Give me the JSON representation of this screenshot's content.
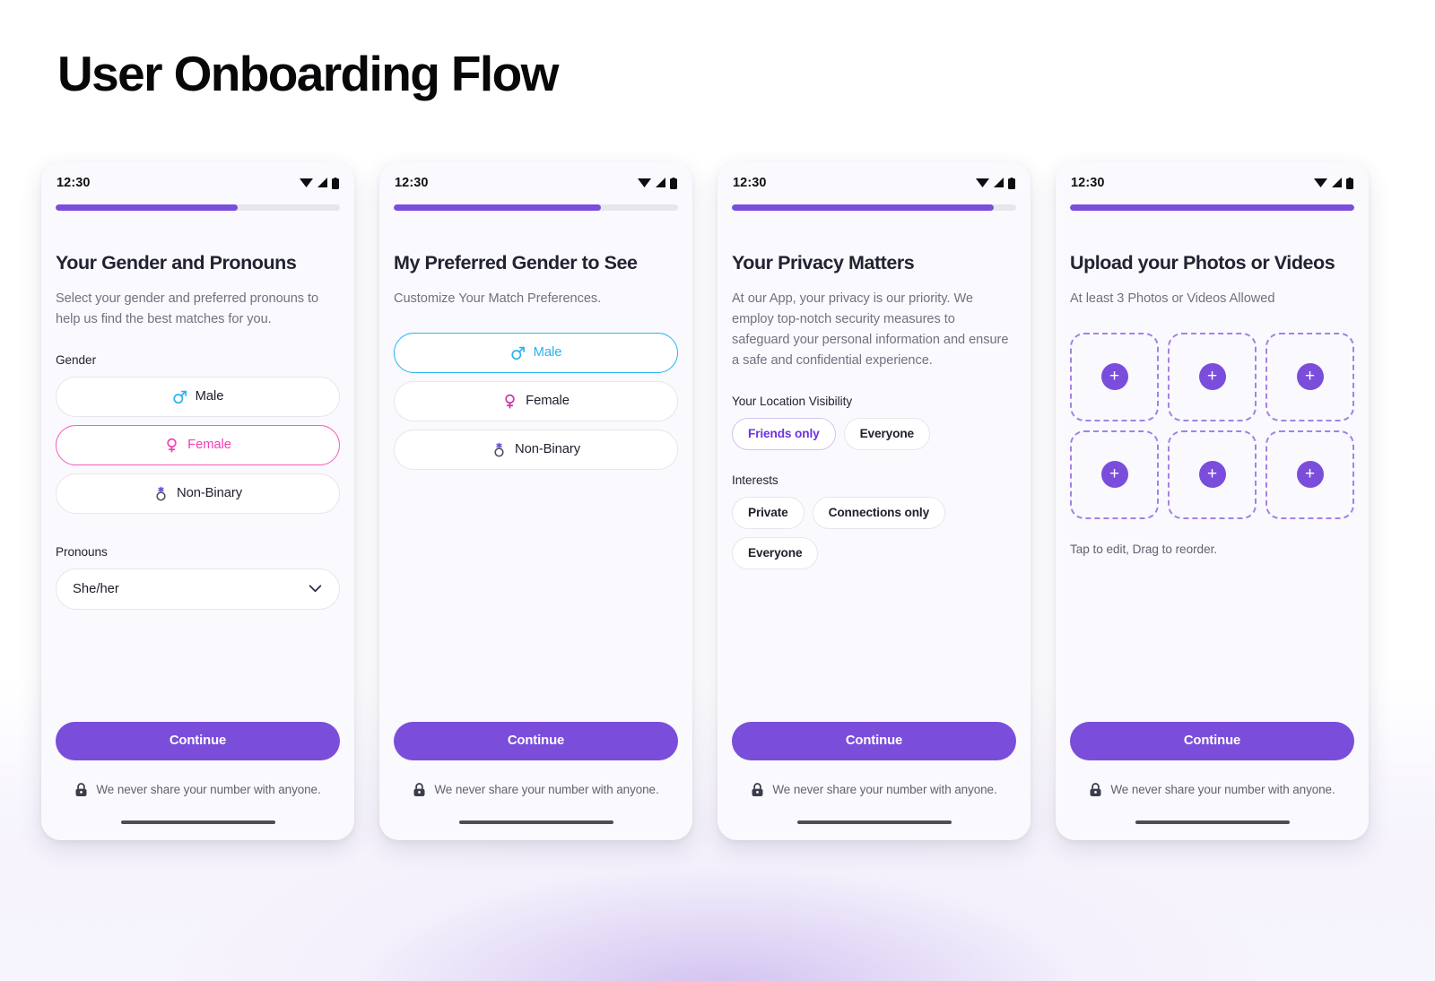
{
  "page": {
    "title": "User Onboarding Flow",
    "accent_purple": "#7a4edb",
    "accent_blue": "#28b4ef",
    "accent_pink": "#f33fb4",
    "heading_color": "#222331",
    "body_color": "#6f7280",
    "phone_bg": "#faf9fd"
  },
  "common": {
    "status_time": "12:30",
    "continue_label": "Continue",
    "footnote": "We never share your number with anyone.",
    "icons": {
      "wifi": "wifi-icon",
      "signal": "signal-icon",
      "battery": "battery-icon",
      "lock": "lock-icon",
      "chevron": "chevron-down-icon",
      "plus": "plus-icon"
    }
  },
  "screens": [
    {
      "id": "gender-pronouns",
      "progress_percent": 64,
      "title": "Your Gender and Pronouns",
      "subtitle": "Select your gender and preferred pronouns to help us find the best matches for you.",
      "gender_label": "Gender",
      "gender_options": [
        {
          "label": "Male",
          "symbol": "♂",
          "state": "default"
        },
        {
          "label": "Female",
          "symbol": "♀",
          "state": "selected-pink"
        },
        {
          "label": "Non-Binary",
          "symbol": "⚧",
          "state": "default"
        }
      ],
      "pronouns_label": "Pronouns",
      "pronouns_value": "She/her"
    },
    {
      "id": "preferred-gender",
      "progress_percent": 73,
      "title": "My Preferred Gender to See",
      "subtitle": "Customize Your Match Preferences.",
      "gender_options": [
        {
          "label": "Male",
          "symbol": "♂",
          "state": "selected-blue"
        },
        {
          "label": "Female",
          "symbol": "♀",
          "state": "default"
        },
        {
          "label": "Non-Binary",
          "symbol": "⚧",
          "state": "default"
        }
      ]
    },
    {
      "id": "privacy",
      "progress_percent": 92,
      "title": "Your Privacy Matters",
      "subtitle": "At our App, your privacy is our priority. We employ top-notch security measures to safeguard your personal information and ensure a safe and confidential experience.",
      "location_label": "Your Location Visibility",
      "location_options": [
        {
          "label": "Friends only",
          "selected": true
        },
        {
          "label": "Everyone",
          "selected": false
        }
      ],
      "interests_label": "Interests",
      "interests_options": [
        {
          "label": "Private",
          "selected": false
        },
        {
          "label": "Connections only",
          "selected": false
        },
        {
          "label": "Everyone",
          "selected": false
        }
      ]
    },
    {
      "id": "upload-media",
      "progress_percent": 100,
      "title": "Upload your Photos or Videos",
      "subtitle": "At least 3 Photos or Videos Allowed",
      "slot_count": 6,
      "hint": "Tap to edit, Drag to reorder."
    }
  ]
}
